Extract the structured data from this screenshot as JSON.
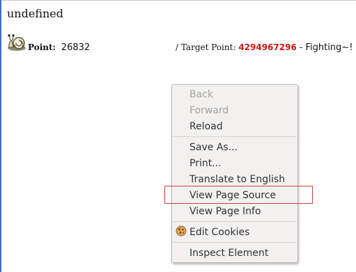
{
  "page": {
    "title": "undefined",
    "point_label": "Point:",
    "point_value": "26832",
    "target_label": "/ Target Point:",
    "target_value": "4294967296",
    "slogan": "- Fighting~!"
  },
  "context_menu": {
    "items": [
      {
        "label": "Back",
        "enabled": false
      },
      {
        "label": "Forward",
        "enabled": false
      },
      {
        "label": "Reload",
        "enabled": true
      },
      {
        "label": "Save As...",
        "enabled": true
      },
      {
        "label": "Print...",
        "enabled": true
      },
      {
        "label": "Translate to English",
        "enabled": true
      },
      {
        "label": "View Page Source",
        "enabled": true,
        "highlighted": true
      },
      {
        "label": "View Page Info",
        "enabled": true
      },
      {
        "label": "Edit Cookies",
        "enabled": true,
        "icon": "cookie-icon"
      },
      {
        "label": "Inspect Element",
        "enabled": true
      }
    ]
  },
  "colors": {
    "target_value": "#d21313",
    "highlight_box": "#d83a3a",
    "menu_background": "#f2f1f0"
  }
}
